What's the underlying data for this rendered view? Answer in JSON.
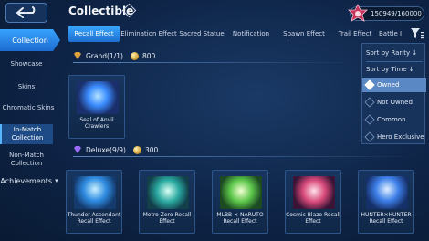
{
  "header": {
    "title": "Collectible",
    "help_glyph": "?",
    "currency_value": "150949/160000"
  },
  "tabs": [
    {
      "label": "Recall Effect",
      "active": true
    },
    {
      "label": "Elimination Effect"
    },
    {
      "label": "Sacred Statue"
    },
    {
      "label": "Notification"
    },
    {
      "label": "Spawn Effect"
    },
    {
      "label": "Trail Effect"
    },
    {
      "label": "Battle I"
    }
  ],
  "sidebar": {
    "main_label": "Collection",
    "items": [
      {
        "label": "Showcase"
      },
      {
        "label": "Skins"
      },
      {
        "label": "Chromatic Skins"
      },
      {
        "label": "In-Match Collection",
        "active": true
      },
      {
        "label": "Non-Match Collection"
      }
    ],
    "achievements_label": "Achievements"
  },
  "sections": [
    {
      "name": "Grand(1/1)",
      "points": "800",
      "items": [
        {
          "label": "Seal of Anvil Crawlers",
          "color": "#3b8cff"
        }
      ]
    },
    {
      "name": "Deluxe(9/9)",
      "points": "300",
      "items": [
        {
          "label": "Thunder Ascendant Recall Effect",
          "color": "#2f8be0"
        },
        {
          "label": "Metro Zero Recall Effect",
          "color": "#2aa9a0"
        },
        {
          "label": "MLBB × NARUTO Recall Effect",
          "color": "#5cc64a"
        },
        {
          "label": "Cosmic Blaze Recall Effect",
          "color": "#d84a7a"
        },
        {
          "label": "HUNTER×HUNTER Recall Effect",
          "color": "#3d7fe8"
        }
      ]
    }
  ],
  "dropdown": {
    "sort_rarity": "Sort by Rarity ↓",
    "sort_time": "Sort by Time ↓",
    "options": [
      {
        "label": "Owned",
        "selected": true
      },
      {
        "label": "Not Owned"
      },
      {
        "label": "Common"
      },
      {
        "label": "Hero Exclusive"
      }
    ]
  },
  "colors": {
    "accent": "#2f8fff",
    "background": "#0e2447",
    "gold": "#d2a039"
  }
}
